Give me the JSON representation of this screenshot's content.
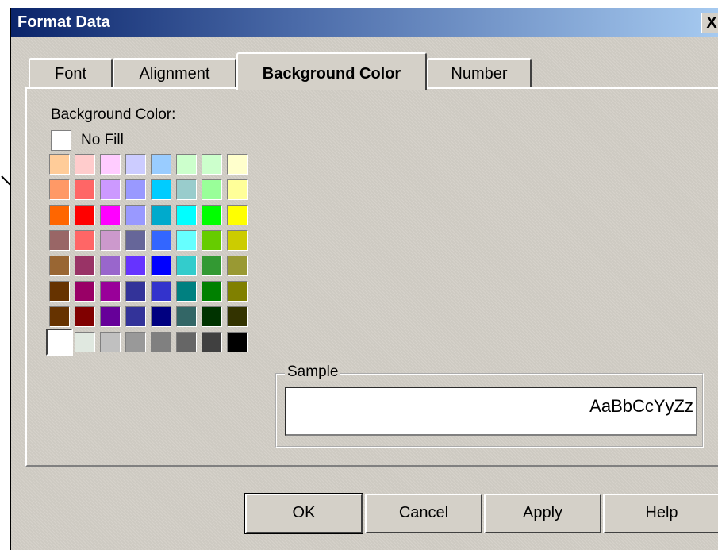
{
  "window": {
    "title": "Format Data",
    "close_label": "X"
  },
  "tabs": [
    {
      "label": "Font",
      "active": false
    },
    {
      "label": "Alignment",
      "active": false
    },
    {
      "label": "Background Color",
      "active": true
    },
    {
      "label": "Number",
      "active": false
    }
  ],
  "background_color": {
    "label": "Background Color:",
    "no_fill_label": "No Fill",
    "palette": [
      [
        "#ffcc99",
        "#ffcccc",
        "#ffccff",
        "#ccccff",
        "#99ccff",
        "#ccffcc",
        "#ccffcc",
        "#ffffcc"
      ],
      [
        "#ff9966",
        "#ff6666",
        "#cc99ff",
        "#9999ff",
        "#00ccff",
        "#99cccc",
        "#99ff99",
        "#ffff99"
      ],
      [
        "#ff6600",
        "#ff0000",
        "#ff00ff",
        "#9999ff",
        "#00aacc",
        "#00ffff",
        "#00ff00",
        "#ffff00"
      ],
      [
        "#996666",
        "#ff6666",
        "#cc99cc",
        "#666699",
        "#3366ff",
        "#66ffff",
        "#66cc00",
        "#cccc00"
      ],
      [
        "#996633",
        "#993366",
        "#9966cc",
        "#6633ff",
        "#0000ff",
        "#33cccc",
        "#339933",
        "#999933"
      ],
      [
        "#663300",
        "#990066",
        "#990099",
        "#333399",
        "#3333cc",
        "#008080",
        "#008000",
        "#808000"
      ],
      [
        "#663300",
        "#800000",
        "#660099",
        "#333399",
        "#000080",
        "#336666",
        "#003300",
        "#333300"
      ],
      [
        "#ffffff",
        "#e0e8e0",
        "#c0c0c0",
        "#999999",
        "#808080",
        "#666666",
        "#404040",
        "#000000"
      ]
    ],
    "selected": "#ffffff"
  },
  "sample": {
    "group_label": "Sample",
    "text": "AaBbCcYyZz"
  },
  "buttons": {
    "ok": "OK",
    "cancel": "Cancel",
    "apply": "Apply",
    "help": "Help"
  }
}
